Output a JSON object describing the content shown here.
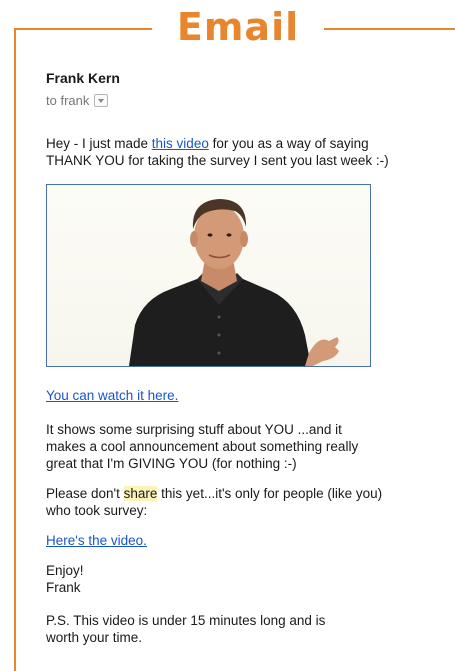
{
  "title": "Email",
  "email": {
    "sender": "Frank Kern",
    "recipient": "to frank",
    "intro_before": "Hey - I just made ",
    "intro_link": "this video",
    "intro_after_line1": " for you as a way of saying",
    "intro_line2": "THANK YOU for taking the survey I sent you last week :-)",
    "watch_link": "You can watch it here.",
    "shows_line1": "It shows some surprising stuff about YOU ...and it",
    "shows_line2": "makes a cool announcement about something really",
    "shows_line3": "great that I'm GIVING YOU (for nothing :-)",
    "please_before": "Please don't ",
    "please_highlight": "share",
    "please_after": " this yet...it's only for people (like you)",
    "please_line2": "who took survey:",
    "video_link": "Here's the video.",
    "sign_line1": "Enjoy!",
    "sign_line2": "Frank",
    "ps_line1": "P.S. This video is under 15 minutes long and is",
    "ps_line2": "worth your time."
  },
  "colors": {
    "accent": "#e8862e",
    "link": "#1a55c7",
    "highlight": "#fbf3b8"
  }
}
